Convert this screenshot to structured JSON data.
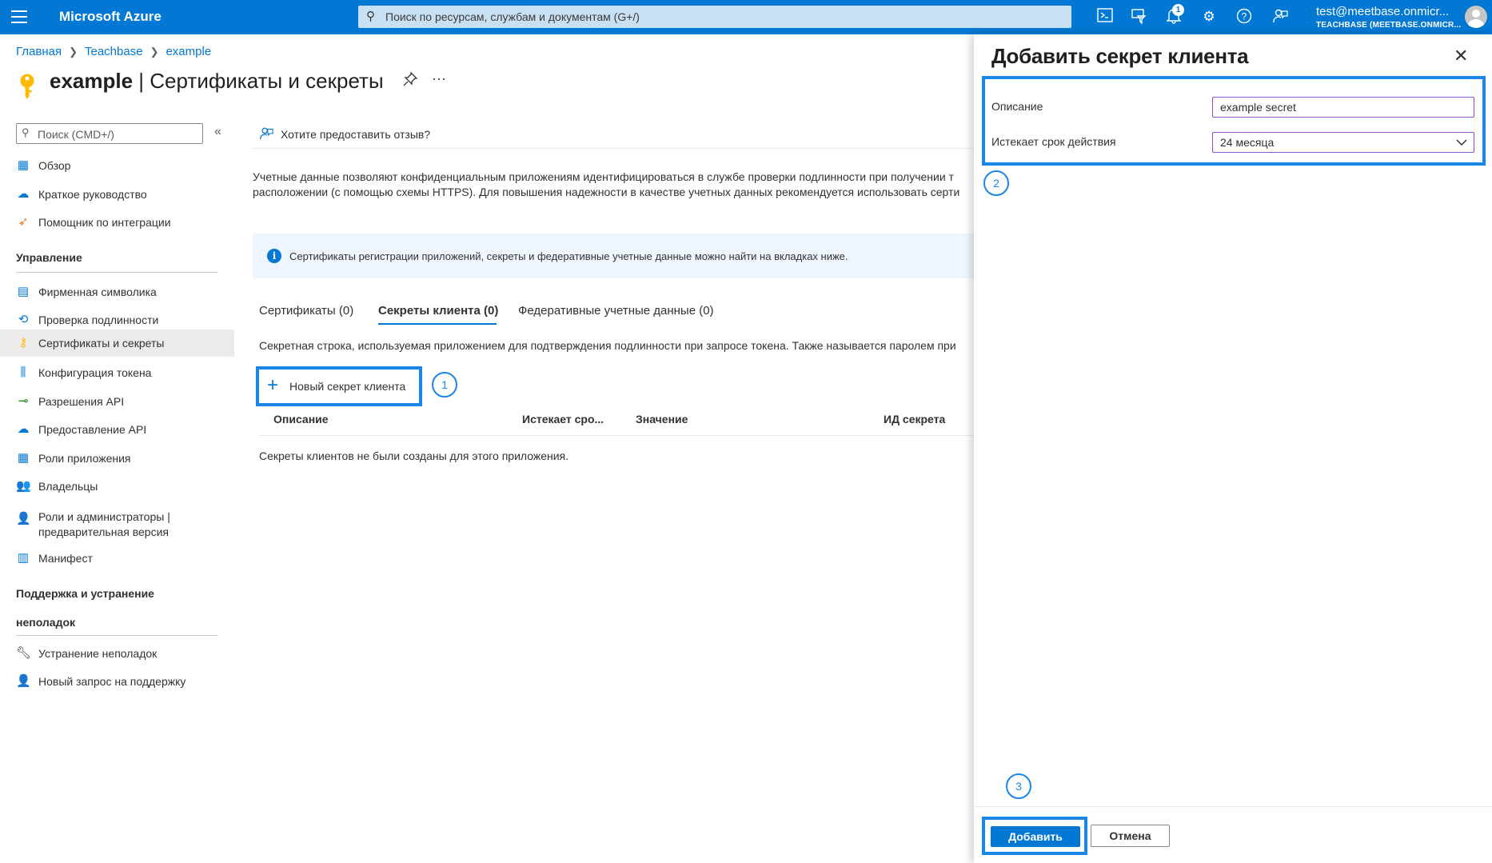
{
  "topbar": {
    "brand": "Microsoft Azure",
    "search_placeholder": "Поиск по ресурсам, службам и документам (G+/)",
    "notification_count": "1",
    "user_email": "test@meetbase.onmicr...",
    "user_org": "TEACHBASE (MEETBASE.ONMICR..."
  },
  "breadcrumb": [
    "Главная",
    "Teachbase",
    "example"
  ],
  "page": {
    "title_bold": "example",
    "title_rest": " | Сертификаты и секреты",
    "more": "···"
  },
  "nav": {
    "search_placeholder": "Поиск (CMD+/)",
    "items_top": [
      {
        "label": "Обзор",
        "icon": "grid-icon"
      },
      {
        "label": "Краткое руководство",
        "icon": "cloud-icon"
      },
      {
        "label": "Помощник по интеграции",
        "icon": "rocket-icon"
      }
    ],
    "section_manage": "Управление",
    "items_manage": [
      {
        "label": "Фирменная символика",
        "icon": "branding-icon"
      },
      {
        "label": "Проверка подлинности",
        "icon": "auth-icon"
      },
      {
        "label": "Сертификаты и секреты",
        "icon": "key-icon"
      },
      {
        "label": "Конфигурация токена",
        "icon": "token-icon"
      },
      {
        "label": "Разрешения API",
        "icon": "api-permissions-icon"
      },
      {
        "label": "Предоставление API",
        "icon": "cloud-api-icon"
      },
      {
        "label": "Роли приложения",
        "icon": "app-roles-icon"
      },
      {
        "label": "Владельцы",
        "icon": "owners-icon"
      },
      {
        "label": "Роли и администраторы | предварительная версия",
        "icon": "admin-roles-icon"
      },
      {
        "label": "Манифест",
        "icon": "manifest-icon"
      }
    ],
    "section_support_1": "Поддержка и устранение",
    "section_support_2": "неполадок",
    "items_support": [
      {
        "label": "Устранение неполадок",
        "icon": "wrench-icon"
      },
      {
        "label": "Новый запрос на поддержку",
        "icon": "support-icon"
      }
    ]
  },
  "main": {
    "feedback": "Хотите предоставить отзыв?",
    "description_1": "Учетные данные позволяют конфиденциальным приложениям идентифицироваться в службе проверки подлинности при получении т",
    "description_2": "расположении (с помощью схемы HTTPS). Для повышения надежности в качестве учетных данных рекомендуется использовать серти",
    "info": "Сертификаты регистрации приложений, секреты и федеративные учетные данные можно найти на вкладках ниже.",
    "tabs": [
      "Сертификаты (0)",
      "Секреты клиента (0)",
      "Федеративные учетные данные (0)"
    ],
    "tab_description": "Секретная строка, используемая приложением для подтверждения подлинности при запросе токена. Также называется паролем при",
    "new_secret_label": "Новый секрет клиента",
    "columns": [
      "Описание",
      "Истекает сро...",
      "Значение",
      "ИД секрета"
    ],
    "empty_message": "Секреты клиентов не были созданы для этого приложения."
  },
  "steps": [
    "1",
    "2",
    "3"
  ],
  "panel": {
    "title": "Добавить секрет клиента",
    "description_label": "Описание",
    "description_value": "example secret",
    "expires_label": "Истекает срок действия",
    "expires_value": "24 месяца",
    "add_label": "Добавить",
    "cancel_label": "Отмена"
  },
  "colors": {
    "accent": "#0078d4",
    "highlight": "#1a86e8",
    "key_yellow": "#ffb900"
  }
}
